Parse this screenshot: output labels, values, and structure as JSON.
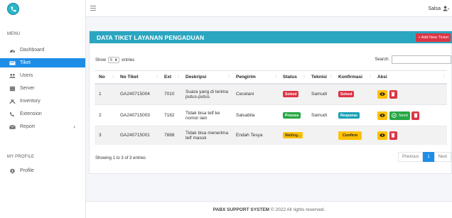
{
  "sidebar": {
    "menu_heading": "MENU",
    "items": [
      {
        "label": "Dashboard"
      },
      {
        "label": "Tiket"
      },
      {
        "label": "Users"
      },
      {
        "label": "Server"
      },
      {
        "label": "Inventory"
      },
      {
        "label": "Extension"
      },
      {
        "label": "Report"
      }
    ],
    "profile_heading": "MY PROFILE",
    "profile_item": "Profile",
    "report_caret": "‹"
  },
  "topbar": {
    "menu_glyph": "≡",
    "user_name": "Salsa"
  },
  "card": {
    "title": "DATA TIKET LAYANAN PENGADUAN",
    "add_button": "+ Add New Ticket"
  },
  "controls": {
    "show_label": "Show",
    "entries_value": "5",
    "entries_label": "entries",
    "search_label": "Search:",
    "search_value": ""
  },
  "table": {
    "headers": [
      "No",
      "No Tiket",
      "Ext",
      "Deskripsi",
      "Pengirim",
      "Status",
      "Teknisi",
      "Konfirmasi",
      "Aksi"
    ],
    "rows": [
      {
        "no": "1",
        "tiket": "GA240715004",
        "ext": "7010",
        "desc": "Suara yang di terima putus-putus",
        "pengirim": "Cecelani",
        "status": "Solved",
        "teknisi": "Samudi",
        "konfirmasi": "Solved",
        "aksi": [
          "view",
          "delete"
        ]
      },
      {
        "no": "2",
        "tiket": "GA240715003",
        "ext": "7182",
        "desc": "Tidak bisa telf ke nomor lain",
        "pengirim": "Salsabila",
        "status": "Process",
        "teknisi": "Samudi",
        "konfirmasi": "Response",
        "aksi": [
          "view",
          "send",
          "delete"
        ],
        "send_label": "Send"
      },
      {
        "no": "3",
        "tiket": "GA240715001",
        "ext": "7888",
        "desc": "Tidak bisa menerima telf masuk",
        "pengirim": "Endah Tesya",
        "status": "Waiting...",
        "teknisi": "",
        "konfirmasi": "Confirm",
        "aksi": [
          "view",
          "delete"
        ]
      }
    ]
  },
  "footer_info": "Showing 1 to 3 of 3 entries",
  "pagination": {
    "previous": "Previous",
    "current": "1",
    "next": "Next"
  },
  "footer": {
    "brand": "PABX SUPPORT SYSTEM",
    "text": "© 2022 All rights reserved."
  },
  "colors": {
    "accent": "#1e8de6",
    "header": "#2aa6c0",
    "danger": "#dc3545",
    "success": "#28a745",
    "warning": "#ffc107",
    "info": "#17a2b8"
  }
}
